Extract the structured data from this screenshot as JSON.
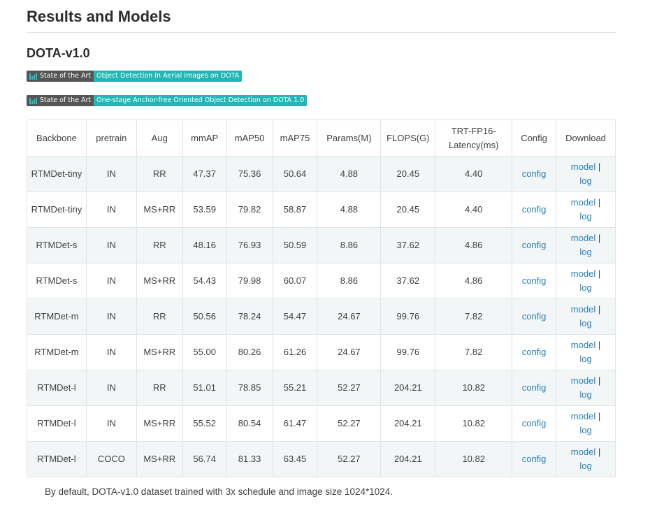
{
  "page": {
    "title": "Results and Models",
    "subtitle": "DOTA-v1.0",
    "note": "By default, DOTA-v1.0 dataset trained with 3x schedule and image size 1024*1024."
  },
  "badges": [
    {
      "left_label": "State of the Art",
      "right_label": "Object Detection In Aerial Images on DOTA"
    },
    {
      "left_label": "State of the Art",
      "right_label": "One-stage Anchor-free Oriented Object Detection on DOTA 1.0"
    }
  ],
  "colors": {
    "badge_left": "#555555",
    "badge_right": "#21b7b7",
    "link": "#2980b9"
  },
  "table": {
    "headers": [
      "Backbone",
      "pretrain",
      "Aug",
      "mmAP",
      "mAP50",
      "mAP75",
      "Params(M)",
      "FLOPS(G)",
      "TRT-FP16-Latency(ms)",
      "Config",
      "Download"
    ],
    "rows": [
      {
        "backbone": "RTMDet-tiny",
        "pretrain": "IN",
        "aug": "RR",
        "mmap": "47.37",
        "map50": "75.36",
        "map75": "50.64",
        "params": "4.88",
        "flops": "20.45",
        "latency": "4.40",
        "config": "config",
        "model": "model",
        "sep": " |",
        "log": "log"
      },
      {
        "backbone": "RTMDet-tiny",
        "pretrain": "IN",
        "aug": "MS+RR",
        "mmap": "53.59",
        "map50": "79.82",
        "map75": "58.87",
        "params": "4.88",
        "flops": "20.45",
        "latency": "4.40",
        "config": "config",
        "model": "model",
        "sep": " |",
        "log": "log"
      },
      {
        "backbone": "RTMDet-s",
        "pretrain": "IN",
        "aug": "RR",
        "mmap": "48.16",
        "map50": "76.93",
        "map75": "50.59",
        "params": "8.86",
        "flops": "37.62",
        "latency": "4.86",
        "config": "config",
        "model": "model",
        "sep": " |",
        "log": "log"
      },
      {
        "backbone": "RTMDet-s",
        "pretrain": "IN",
        "aug": "MS+RR",
        "mmap": "54.43",
        "map50": "79.98",
        "map75": "60.07",
        "params": "8.86",
        "flops": "37.62",
        "latency": "4.86",
        "config": "config",
        "model": "model",
        "sep": " |",
        "log": "log"
      },
      {
        "backbone": "RTMDet-m",
        "pretrain": "IN",
        "aug": "RR",
        "mmap": "50.56",
        "map50": "78.24",
        "map75": "54.47",
        "params": "24.67",
        "flops": "99.76",
        "latency": "7.82",
        "config": "config",
        "model": "model",
        "sep": " |",
        "log": "log"
      },
      {
        "backbone": "RTMDet-m",
        "pretrain": "IN",
        "aug": "MS+RR",
        "mmap": "55.00",
        "map50": "80.26",
        "map75": "61.26",
        "params": "24.67",
        "flops": "99.76",
        "latency": "7.82",
        "config": "config",
        "model": "model",
        "sep": " |",
        "log": "log"
      },
      {
        "backbone": "RTMDet-l",
        "pretrain": "IN",
        "aug": "RR",
        "mmap": "51.01",
        "map50": "78.85",
        "map75": "55.21",
        "params": "52.27",
        "flops": "204.21",
        "latency": "10.82",
        "config": "config",
        "model": "model",
        "sep": " |",
        "log": "log"
      },
      {
        "backbone": "RTMDet-l",
        "pretrain": "IN",
        "aug": "MS+RR",
        "mmap": "55.52",
        "map50": "80.54",
        "map75": "61.47",
        "params": "52.27",
        "flops": "204.21",
        "latency": "10.82",
        "config": "config",
        "model": "model",
        "sep": " |",
        "log": "log"
      },
      {
        "backbone": "RTMDet-l",
        "pretrain": "COCO",
        "aug": "MS+RR",
        "mmap": "56.74",
        "map50": "81.33",
        "map75": "63.45",
        "params": "52.27",
        "flops": "204.21",
        "latency": "10.82",
        "config": "config",
        "model": "model",
        "sep": " |",
        "log": "log"
      }
    ]
  }
}
